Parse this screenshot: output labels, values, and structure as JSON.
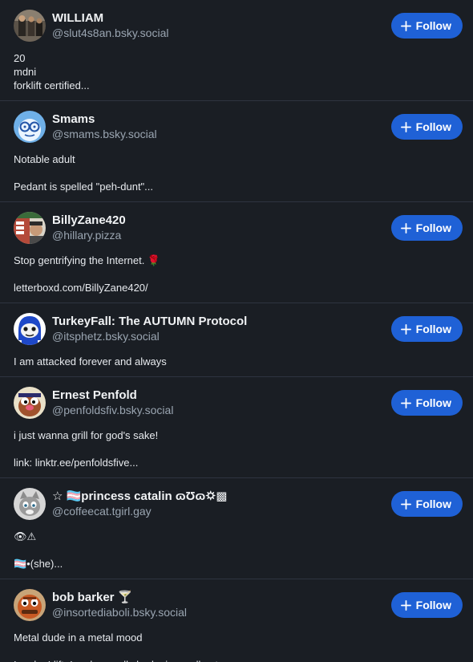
{
  "colors": {
    "background": "#1a1e24",
    "divider": "#2e3440",
    "follow_button": "#1f61d6",
    "handle_text": "#9aa5b1"
  },
  "follow_label": "Follow",
  "users": [
    {
      "name": "WILLIAM",
      "handle": "@slut4s8an.bsky.social",
      "avatar": "photo-avatar",
      "bio": [
        "20",
        "mdni",
        "forklift certified..."
      ]
    },
    {
      "name": "Smams",
      "handle": "@smams.bsky.social",
      "avatar": "cartoon-glasses-avatar",
      "bio": [
        "Notable adult",
        "",
        "Pedant is spelled \"peh-dunt\"..."
      ]
    },
    {
      "name": "BillyZane420",
      "handle": "@hillary.pizza",
      "avatar": "photo-avatar",
      "bio": [
        "Stop gentrifying the Internet. 🌹",
        "",
        "letterboxd.com/BillyZane420/"
      ]
    },
    {
      "name": "TurkeyFall: The AUTUMN Protocol",
      "handle": "@itsphetz.bsky.social",
      "avatar": "cartoon-helmet-avatar",
      "bio": [
        "I am attacked forever and always"
      ]
    },
    {
      "name": "Ernest Penfold",
      "handle": "@penfoldsfiv.bsky.social",
      "avatar": "cartoon-mole-avatar",
      "bio": [
        "i just wanna grill for god's sake!",
        "",
        "link: linktr.ee/penfoldsfive..."
      ]
    },
    {
      "name": "☆ 🏳️‍⚧️princess catalin ɷƱɷ🌣▩",
      "handle": "@coffeecat.tgirl.gay",
      "avatar": "cartoon-cat-avatar",
      "bio": [
        "👁⚠",
        "",
        "🏳️‍⚧️•(she)..."
      ]
    },
    {
      "name": "bob barker 🍸",
      "handle": "@insortediaboli.bsky.social",
      "avatar": "cartoon-face-avatar",
      "bio": [
        "Metal dude in a metal mood",
        "",
        "I code, I lift, I make small shrubs in small pots"
      ]
    }
  ]
}
